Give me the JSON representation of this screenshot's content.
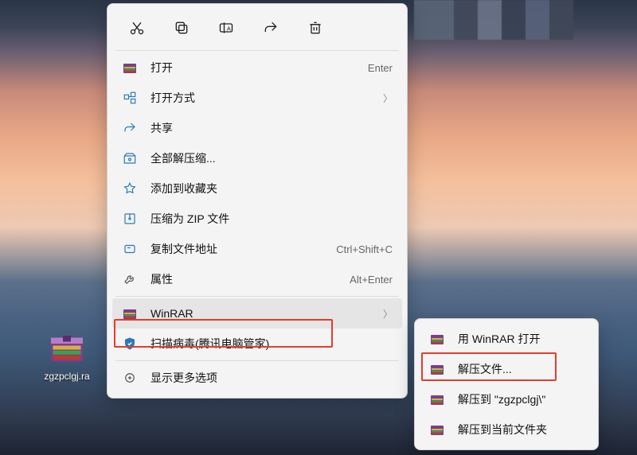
{
  "desktop": {
    "file_label": "zgzpclgj.ra"
  },
  "toolbar": {
    "cut": "cut-icon",
    "copy": "copy-icon",
    "rename": "rename-icon",
    "share": "share-icon",
    "delete": "delete-icon"
  },
  "menu": {
    "open": {
      "label": "打开",
      "hint": "Enter"
    },
    "open_with": {
      "label": "打开方式"
    },
    "share": {
      "label": "共享"
    },
    "extract_all": {
      "label": "全部解压缩..."
    },
    "favorite": {
      "label": "添加到收藏夹"
    },
    "zip": {
      "label": "压缩为 ZIP 文件"
    },
    "copy_path": {
      "label": "复制文件地址",
      "hint": "Ctrl+Shift+C"
    },
    "properties": {
      "label": "属性",
      "hint": "Alt+Enter"
    },
    "winrar": {
      "label": "WinRAR"
    },
    "scan": {
      "label": "扫描病毒(腾讯电脑管家)"
    },
    "more": {
      "label": "显示更多选项"
    }
  },
  "submenu": {
    "open_with_winrar": {
      "label": "用 WinRAR 打开"
    },
    "extract_files": {
      "label": "解压文件..."
    },
    "extract_to": {
      "label": "解压到 \"zgzpclgj\\\""
    },
    "extract_here": {
      "label": "解压到当前文件夹"
    }
  }
}
